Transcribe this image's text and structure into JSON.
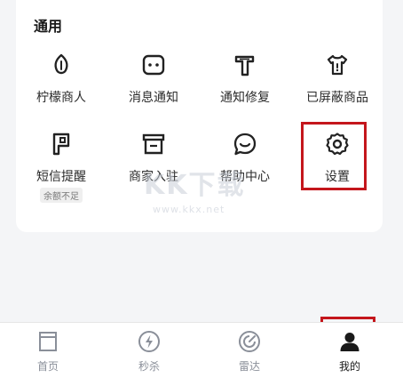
{
  "section": {
    "title": "通用"
  },
  "grid": [
    {
      "label": "柠檬商人",
      "icon": "lemon-icon"
    },
    {
      "label": "消息通知",
      "icon": "message-icon"
    },
    {
      "label": "通知修复",
      "icon": "repair-icon"
    },
    {
      "label": "已屏蔽商品",
      "icon": "blocked-goods-icon"
    },
    {
      "label": "短信提醒",
      "icon": "sms-icon",
      "badge": "余额不足"
    },
    {
      "label": "商家入驻",
      "icon": "store-icon"
    },
    {
      "label": "帮助中心",
      "icon": "help-chat-icon"
    },
    {
      "label": "设置",
      "icon": "gear-icon"
    }
  ],
  "tabs": [
    {
      "label": "首页",
      "icon": "home-icon"
    },
    {
      "label": "秒杀",
      "icon": "flash-icon"
    },
    {
      "label": "雷达",
      "icon": "radar-icon"
    },
    {
      "label": "我的",
      "icon": "user-icon",
      "active": true
    }
  ],
  "watermark": {
    "text": "KK下载",
    "url": "www.kkx.net"
  },
  "colors": {
    "highlight": "#c4161c",
    "icon": "#222222",
    "tab_inactive": "#8a8f99"
  }
}
